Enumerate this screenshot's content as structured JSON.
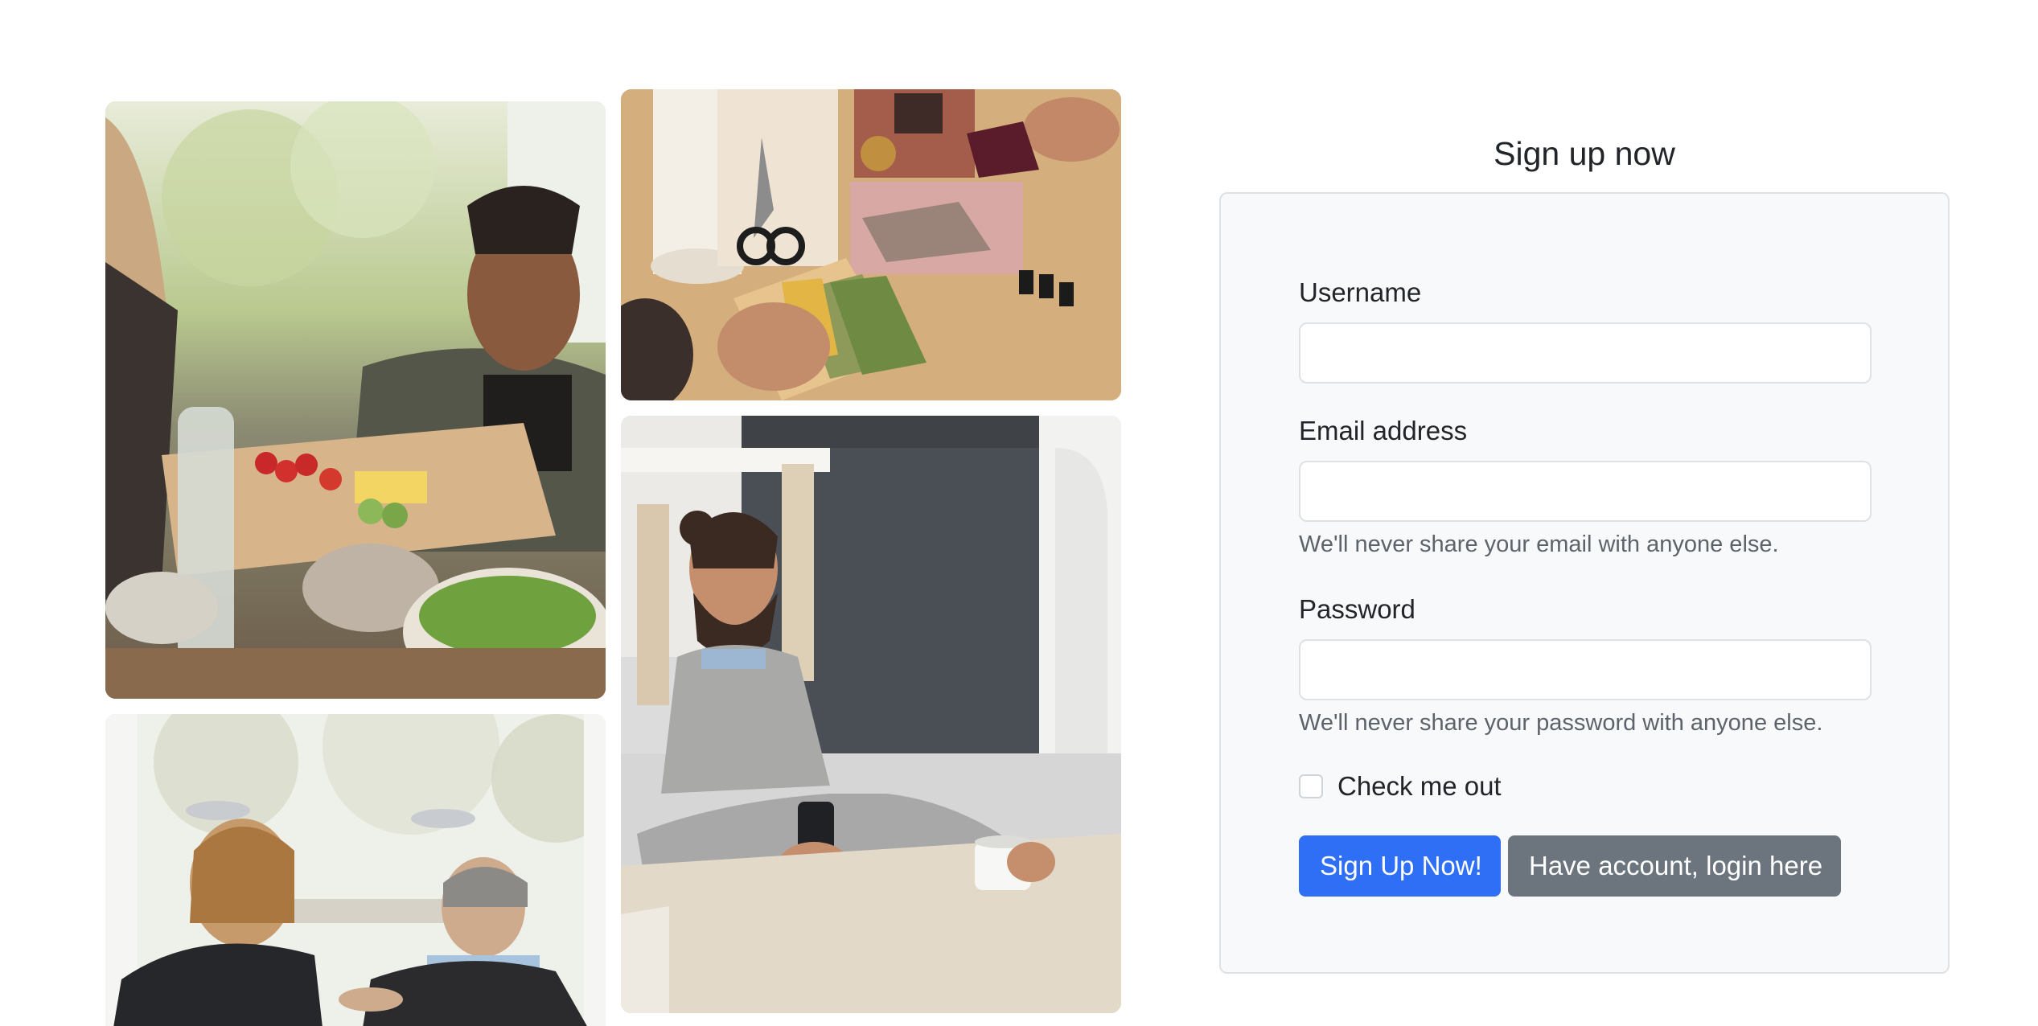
{
  "images": [
    {
      "name": "dinner-table-photo",
      "subject": "people sharing a meal at a table"
    },
    {
      "name": "fabric-swatches-photo",
      "subject": "hands with fabric swatches and scissors"
    },
    {
      "name": "man-with-phone-photo",
      "subject": "bearded man smiling at phone with coffee"
    },
    {
      "name": "couple-window-photo",
      "subject": "couple sitting by a window"
    }
  ],
  "form": {
    "title": "Sign up now",
    "username_label": "Username",
    "username_value": "",
    "email_label": "Email address",
    "email_value": "",
    "email_help": "We'll never share your email with anyone else.",
    "password_label": "Password",
    "password_value": "",
    "password_help": "We'll never share your password with anyone else.",
    "checkbox_label": "Check me out",
    "checkbox_checked": false,
    "submit_label": "Sign Up Now!",
    "login_label": "Have account, login here"
  },
  "colors": {
    "primary": "#2f6ff5",
    "secondary": "#6c757d",
    "card_bg": "#f8f9fa",
    "border": "#dee2e6"
  }
}
